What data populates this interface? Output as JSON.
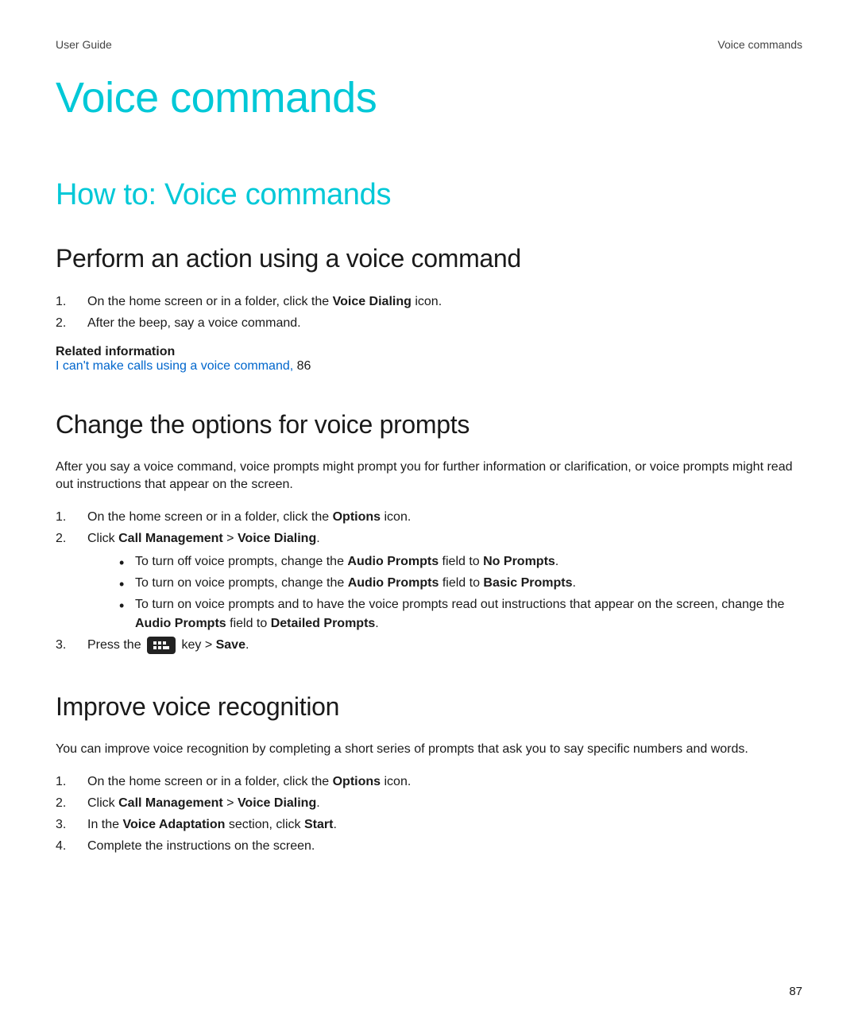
{
  "header": {
    "left": "User Guide",
    "right": "Voice commands"
  },
  "title": "Voice commands",
  "section": "How to: Voice commands",
  "sub1": {
    "heading": "Perform an action using a voice command",
    "step1_pre": "On the home screen or in a folder, click the ",
    "step1_bold": "Voice Dialing",
    "step1_post": " icon.",
    "step2": "After the beep, say a voice command.",
    "related_heading": "Related information",
    "related_link": "I can't make calls using a voice command,",
    "related_page": " 86"
  },
  "sub2": {
    "heading": "Change the options for voice prompts",
    "intro": "After you say a voice command, voice prompts might prompt you for further information or clarification, or voice prompts might read out instructions that appear on the screen.",
    "step1_pre": "On the home screen or in a folder, click the ",
    "step1_bold": "Options",
    "step1_post": " icon.",
    "step2_pre": "Click ",
    "step2_b1": "Call Management",
    "step2_mid": " > ",
    "step2_b2": "Voice Dialing",
    "step2_post": ".",
    "bullet1_pre": "To turn off voice prompts, change the ",
    "bullet1_b1": "Audio Prompts",
    "bullet1_mid": " field to ",
    "bullet1_b2": "No Prompts",
    "bullet1_post": ".",
    "bullet2_pre": "To turn on voice prompts, change the ",
    "bullet2_b1": "Audio Prompts",
    "bullet2_mid": " field to ",
    "bullet2_b2": "Basic Prompts",
    "bullet2_post": ".",
    "bullet3_pre": "To turn on voice prompts and to have the voice prompts read out instructions that appear on the screen, change the ",
    "bullet3_b1": "Audio Prompts",
    "bullet3_mid": " field to ",
    "bullet3_b2": "Detailed Prompts",
    "bullet3_post": ".",
    "step3_pre": "Press the ",
    "step3_mid": " key > ",
    "step3_bold": "Save",
    "step3_post": "."
  },
  "sub3": {
    "heading": "Improve voice recognition",
    "intro": "You can improve voice recognition by completing a short series of prompts that ask you to say specific numbers and words.",
    "step1_pre": "On the home screen or in a folder, click the ",
    "step1_bold": "Options",
    "step1_post": " icon.",
    "step2_pre": "Click ",
    "step2_b1": "Call Management",
    "step2_mid": " > ",
    "step2_b2": "Voice Dialing",
    "step2_post": ".",
    "step3_pre": "In the ",
    "step3_b1": "Voice Adaptation",
    "step3_mid": " section, click ",
    "step3_b2": "Start",
    "step3_post": ".",
    "step4": "Complete the instructions on the screen."
  },
  "page_number": "87"
}
